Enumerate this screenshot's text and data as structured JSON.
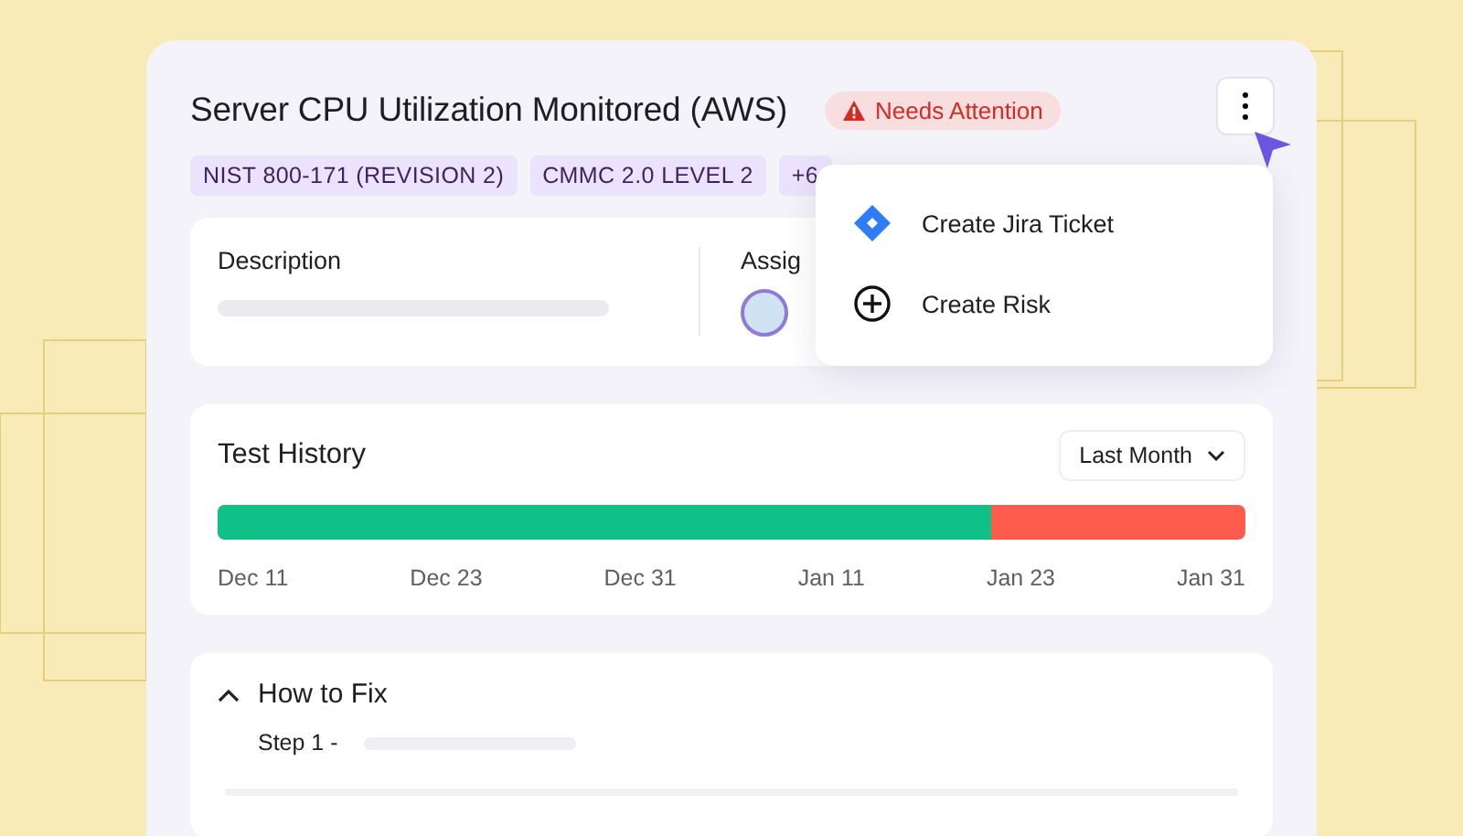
{
  "title": "Server CPU Utilization Monitored (AWS)",
  "status_badge": {
    "label": "Needs Attention"
  },
  "tags": [
    "NIST 800-171 (REVISION 2)",
    "CMMC 2.0 LEVEL 2",
    "+6"
  ],
  "description": {
    "label": "Description"
  },
  "assignee": {
    "label": "Assig"
  },
  "menu": {
    "open": true,
    "items": [
      {
        "kind": "jira",
        "label": "Create Jira Ticket"
      },
      {
        "kind": "add",
        "label": "Create Risk"
      }
    ]
  },
  "test_history": {
    "title": "Test History",
    "range": "Last Month",
    "bar": {
      "level": 0.753
    },
    "dates": [
      "Dec 11",
      "Dec 23",
      "Dec 31",
      "Jan 11",
      "Jan 23",
      "Jan 31"
    ]
  },
  "how_to_fix": {
    "title": "How to Fix",
    "expanded": true,
    "steps": [
      "Step 1 -"
    ]
  }
}
